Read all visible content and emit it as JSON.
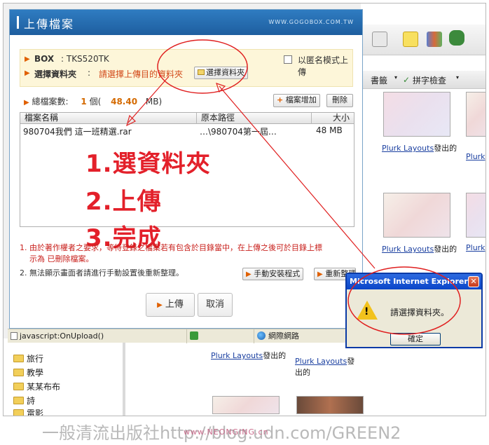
{
  "dialog": {
    "title": "上傳檔案",
    "url_text": "WWW.GOGOBOX.COM.TW",
    "box_label": "BOX",
    "box_value": ": TKS520TK",
    "folder_label": "選擇資料夾",
    "folder_sep": ":",
    "folder_hint": "請選擇上傳目的資料夾",
    "select_folder_button": "選擇資料夾",
    "anonymous_label": "以匿名模式上傳",
    "total_label": "總檔案數:",
    "total_count": "1",
    "total_mid": "個(",
    "total_size": "48.40",
    "total_unit": "MB)",
    "add_file_button": "檔案增加",
    "delete_button": "刪除",
    "columns": [
      "檔案名稱",
      "原本路徑",
      "大小"
    ],
    "rows": [
      {
        "name": "980704我們 這一班精選.rar",
        "path": "…\\980704第一屆…",
        "size": "48 MB"
      }
    ],
    "steps": [
      "1.選資料夾",
      "2.上傳",
      "3.完成"
    ],
    "note1": "1. 由於著作權者之要求，等待登錄之檔案若有包含於目錄當中，在上傳之後可於目錄上標",
    "note1b": "示為  已刪除檔案。",
    "note2": "2. 無法顯示畫面者請進行手動設置後重新整理。",
    "manual_install_button": "手動安裝程式",
    "refresh_button": "重新整理",
    "upload_button": "上傳",
    "cancel_button": "取消"
  },
  "status_bar": {
    "script": "javascript:OnUpload()",
    "zone": "網際網路"
  },
  "alert": {
    "title": "Microsoft Internet Explorer",
    "message": "請選擇資料夾。",
    "ok_button": "確定"
  },
  "background": {
    "toolbar_bookmarks": "書籤",
    "toolbar_spell": "拼字檢查",
    "links": [
      {
        "link": "Plurk Layouts",
        "suffix": "發出的"
      },
      {
        "link": "Plurk",
        "suffix": ""
      },
      {
        "link": "Plurk Layouts",
        "suffix": "發出的"
      },
      {
        "link": "Plurk",
        "suffix": ""
      },
      {
        "link": "Plurk Layouts",
        "suffix": "發出的"
      },
      {
        "link": "Plurk Layouts",
        "suffix": "發出的"
      }
    ],
    "folders": [
      "旅行",
      "教學",
      "某某布布",
      "詩",
      "電影"
    ]
  },
  "footer": {
    "text": "一般清流出版社http://blog.udn.com/GREEN2",
    "logo": "www.NEONGING.cn"
  },
  "colors": {
    "title_blue": "#1e5e9f",
    "step_red": "#e3202a",
    "annotation_red": "#e02020"
  }
}
